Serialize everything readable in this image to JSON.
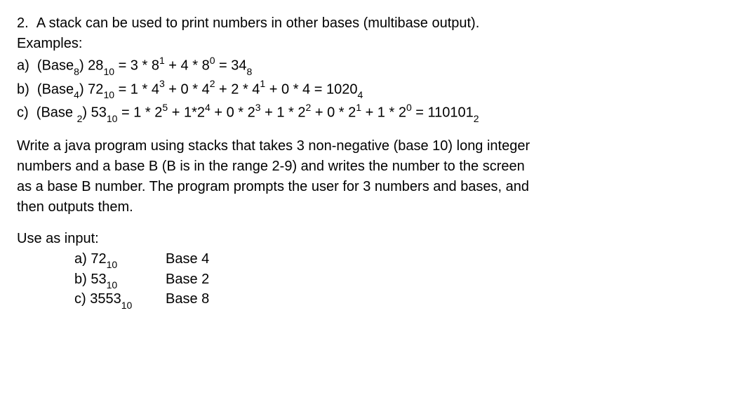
{
  "q": {
    "num": "2.",
    "intro": "A stack can be used to print numbers in other bases (multibase output).",
    "examples_label": "Examples:",
    "ex": {
      "a_label": "a)",
      "a_prefix": "(Base",
      "a_base": "8",
      "a_close": ")  28",
      "a_sub1": "10",
      "a_eq1": "  =  3 * 8",
      "a_sup1": "1",
      "a_mid1": "  +  4 * 8",
      "a_sup2": "0",
      "a_eq2": "  =  34",
      "a_sub2": "8",
      "b_label": "b)",
      "b_prefix": "(Base",
      "b_base": "4",
      "b_close": ") 72",
      "b_sub1": "10",
      "b_eq1": " =  1 * 4",
      "b_sup1": "3",
      "b_mid1": "  + 0 * 4",
      "b_sup2": "2",
      "b_mid2": "  + 2 * 4",
      "b_sup3": "1",
      "b_mid3": "  + 0 * 4  =  1020",
      "b_sub2": "4",
      "c_label": "c)",
      "c_prefix": "(Base ",
      "c_base": "2",
      "c_close": ") 53",
      "c_sub1": "10",
      "c_eq1": " = 1 * 2",
      "c_sup1": "5",
      "c_mid1": "  +  1*2",
      "c_sup2": "4",
      "c_mid2": "  + 0 * 2",
      "c_sup3": "3",
      "c_mid3": "  + 1 * 2",
      "c_sup4": "2",
      "c_mid4": "  + 0 * 2",
      "c_sup5": "1",
      "c_mid5": "  + 1 * 2",
      "c_sup6": "0",
      "c_eq2": " = 110101",
      "c_sub2": "2"
    },
    "task1": "Write a java program using stacks that takes 3 non-negative (base 10) long integer",
    "task2": "numbers and a base B (B is in the range 2-9) and writes the number to the screen",
    "task3": "as a base B number. The program prompts the user for 3 numbers and bases, and",
    "task4": "then outputs them.",
    "use_label": "Use as input:",
    "in": {
      "a_l": "a)  72",
      "a_sub": "10",
      "a_r": "Base 4",
      "b_l": "b)  53",
      "b_sub": "10",
      "b_r": "Base 2",
      "c_l": "c)  3553",
      "c_sub": "10",
      "c_r": "Base 8"
    }
  }
}
